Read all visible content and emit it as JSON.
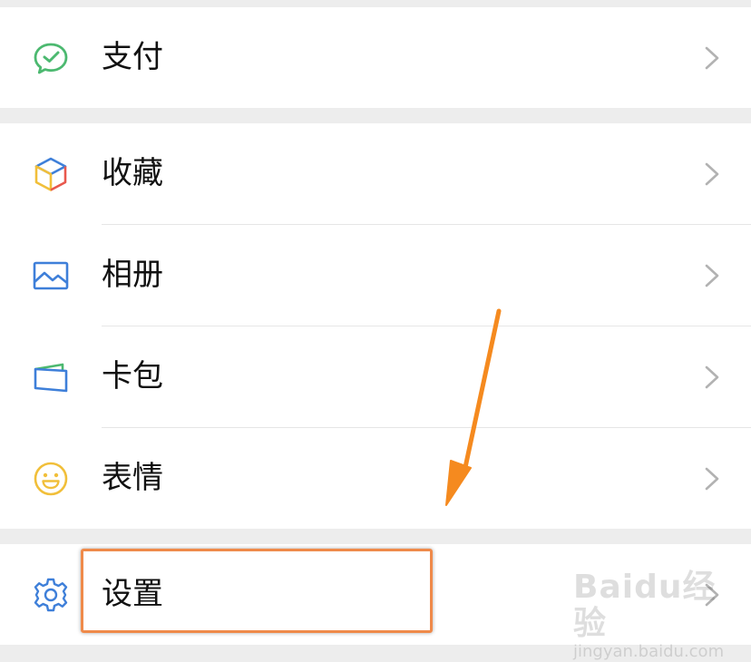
{
  "menu": {
    "items": [
      {
        "label": "支付",
        "icon": "wechat-pay-icon"
      },
      {
        "label": "收藏",
        "icon": "favorites-cube-icon"
      },
      {
        "label": "相册",
        "icon": "photo-album-icon"
      },
      {
        "label": "卡包",
        "icon": "card-wallet-icon"
      },
      {
        "label": "表情",
        "icon": "smiley-face-icon"
      },
      {
        "label": "设置",
        "icon": "gear-icon"
      }
    ]
  },
  "watermark": {
    "main": "Baidu经验",
    "sub": "jingyan.baidu.com"
  },
  "colors": {
    "background": "#ededed",
    "row": "#ffffff",
    "pay_green": "#4cb970",
    "accent_blue": "#3e7fd9",
    "smiley_yellow": "#f1bf3a",
    "annotation_orange": "#f58a1f"
  }
}
